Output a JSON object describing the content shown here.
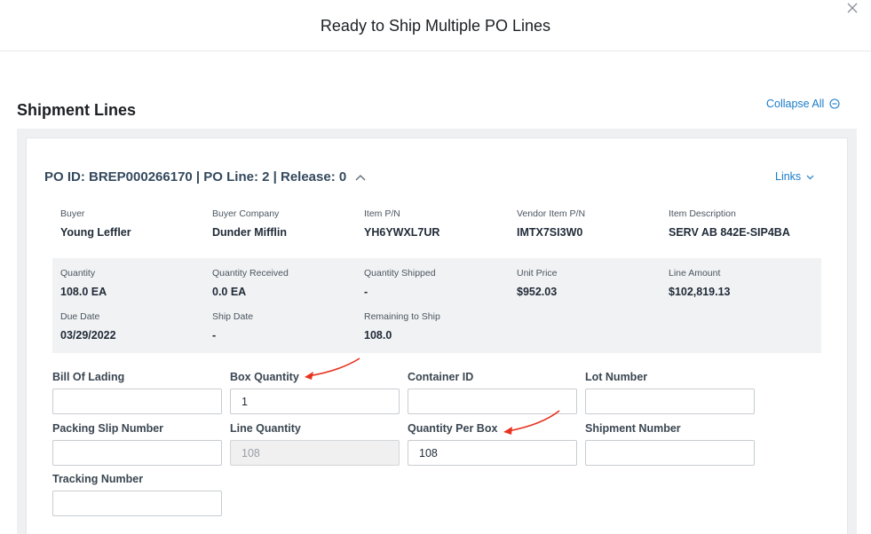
{
  "modal": {
    "title": "Ready to Ship Multiple PO Lines"
  },
  "section": {
    "title": "Shipment Lines",
    "collapse_label": "Collapse All"
  },
  "po": {
    "header": "PO ID: BREP000266170 | PO Line: 2 | Release: 0",
    "links_label": "Links",
    "details": [
      {
        "label": "Buyer",
        "value": "Young Leffler"
      },
      {
        "label": "Buyer Company",
        "value": "Dunder Mifflin"
      },
      {
        "label": "Item P/N",
        "value": "YH6YWXL7UR"
      },
      {
        "label": "Vendor Item P/N",
        "value": "IMTX7SI3W0"
      },
      {
        "label": "Item Description",
        "value": "SERV AB 842E-SIP4BA"
      }
    ],
    "metrics": [
      {
        "label": "Quantity",
        "value": "108.0 EA"
      },
      {
        "label": "Quantity Received",
        "value": "0.0 EA"
      },
      {
        "label": "Quantity Shipped",
        "value": "-"
      },
      {
        "label": "Unit Price",
        "value": "$952.03"
      },
      {
        "label": "Line Amount",
        "value": "$102,819.13"
      },
      {
        "label": "Due Date",
        "value": "03/29/2022"
      },
      {
        "label": "Ship Date",
        "value": "-"
      },
      {
        "label": "Remaining to Ship",
        "value": "108.0"
      }
    ]
  },
  "form": {
    "bill_of_lading": {
      "label": "Bill Of Lading",
      "value": ""
    },
    "box_quantity": {
      "label": "Box Quantity",
      "value": "1"
    },
    "container_id": {
      "label": "Container ID",
      "value": ""
    },
    "lot_number": {
      "label": "Lot Number",
      "value": ""
    },
    "packing_slip_number": {
      "label": "Packing Slip Number",
      "value": ""
    },
    "line_quantity": {
      "label": "Line Quantity",
      "value": "108"
    },
    "quantity_per_box": {
      "label": "Quantity Per Box",
      "value": "108"
    },
    "shipment_number": {
      "label": "Shipment Number",
      "value": ""
    },
    "tracking_number": {
      "label": "Tracking Number",
      "value": ""
    }
  },
  "colors": {
    "link": "#1b7bc9",
    "annotation_arrow": "#e8321e",
    "panel_grey": "#eff0f1"
  },
  "icons": [
    "close-icon",
    "collapse-circle-icon",
    "chevron-up-icon",
    "chevron-down-icon",
    "annotation-arrow"
  ]
}
